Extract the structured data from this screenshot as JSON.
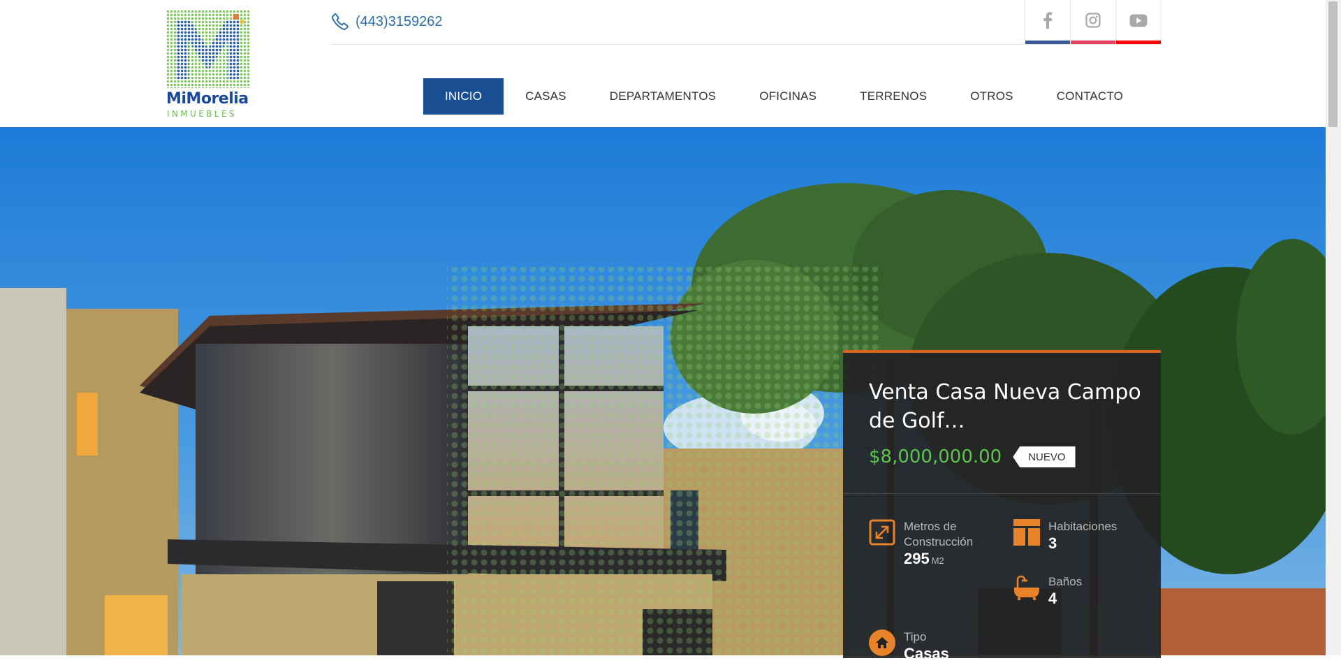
{
  "logo": {
    "brand": "MiMorelia",
    "sub": "INMUEBLES",
    "icon": "mimorelia-logo-icon"
  },
  "contact": {
    "phone": "(443)3159262",
    "icon": "phone-icon"
  },
  "social": [
    {
      "name": "facebook",
      "icon": "facebook-icon",
      "color": "#3b5998"
    },
    {
      "name": "instagram",
      "icon": "instagram-icon",
      "color": "#e4405f"
    },
    {
      "name": "youtube",
      "icon": "youtube-icon",
      "color": "#ff0000"
    }
  ],
  "nav": {
    "items": [
      {
        "label": "INICIO",
        "active": true
      },
      {
        "label": "CASAS"
      },
      {
        "label": "DEPARTAMENTOS"
      },
      {
        "label": "OFICINAS"
      },
      {
        "label": "TERRENOS"
      },
      {
        "label": "OTROS"
      },
      {
        "label": "CONTACTO"
      }
    ],
    "active_color": "#1a4f93"
  },
  "property": {
    "title": "Venta Casa Nueva Campo de Golf…",
    "price": "$8,000,000.00",
    "badge": "NUEVO",
    "accent_color": "#e0651a",
    "price_color": "#5cc44f",
    "features": {
      "construction": {
        "label": "Metros de Construcción",
        "value": "295",
        "unit": "M2",
        "icon": "area-expand-icon"
      },
      "rooms": {
        "label": "Habitaciones",
        "value": "3",
        "icon": "rooms-grid-icon"
      },
      "baths": {
        "label": "Baños",
        "value": "4",
        "icon": "bathtub-icon"
      },
      "type": {
        "label": "Tipo",
        "value": "Casas",
        "icon": "home-icon"
      }
    }
  }
}
